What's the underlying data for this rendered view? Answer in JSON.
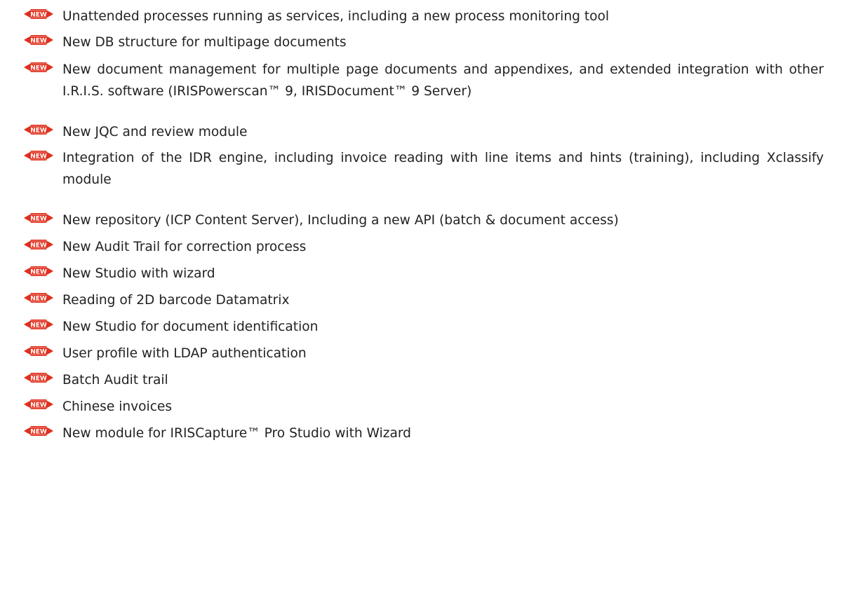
{
  "badge": {
    "text": "NEW",
    "color": "#e0301e",
    "icon": "new-badge-icon"
  },
  "features": [
    {
      "text": "Unattended processes running as services, including a new process monitoring tool"
    },
    {
      "text": "New DB structure for multipage documents"
    },
    {
      "text": "New document management for multiple page documents and appendixes, and extended integration with other I.R.I.S. software (IRISPowerscan™ 9, IRISDocument™ 9 Server)"
    },
    {
      "text": "New JQC and review module"
    },
    {
      "text": "Integration of the IDR engine, including invoice reading with line items and hints (training), including Xclassify module"
    },
    {
      "text": "New repository (ICP Content Server), Including a new API (batch & document access)"
    },
    {
      "text": "New Audit Trail for correction process"
    },
    {
      "text": "New Studio with wizard"
    },
    {
      "text": "Reading of 2D barcode Datamatrix"
    },
    {
      "text": "New Studio for document identification"
    },
    {
      "text": "User profile with LDAP authentication"
    },
    {
      "text": "Batch Audit trail"
    },
    {
      "text": "Chinese invoices"
    },
    {
      "text": "New module for IRISCapture™ Pro Studio with Wizard"
    }
  ]
}
